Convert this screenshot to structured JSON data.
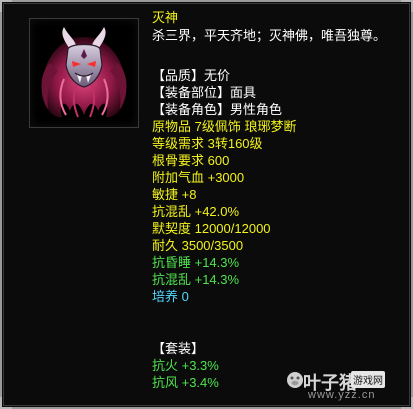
{
  "item": {
    "name": "灭神",
    "desc": "杀三界，平天齐地；灭神佛，唯吾独尊。",
    "icon": "demon-mask-icon"
  },
  "attributes": [
    {
      "text": "【品质】无价",
      "color": "white"
    },
    {
      "text": "【装备部位】面具",
      "color": "white"
    },
    {
      "text": "【装备角色】男性角色",
      "color": "white"
    },
    {
      "text": "原物品 7级佩饰 琅琊梦断",
      "color": "yellow"
    },
    {
      "text": "等级需求 3转160级",
      "color": "yellow"
    },
    {
      "text": "根骨要求 600",
      "color": "yellow"
    },
    {
      "text": "附加气血 +3000",
      "color": "yellow"
    },
    {
      "text": "敏捷 +8",
      "color": "yellow"
    },
    {
      "text": "抗混乱 +42.0%",
      "color": "yellow"
    },
    {
      "text": "默契度 12000/12000",
      "color": "yellow"
    },
    {
      "text": "耐久 3500/3500",
      "color": "yellow"
    },
    {
      "text": "抗昏睡 +14.3%",
      "color": "green"
    },
    {
      "text": "抗混乱 +14.3%",
      "color": "green"
    },
    {
      "text": "培养 0",
      "color": "cyan"
    }
  ],
  "set": {
    "title": "【套装】",
    "items": [
      {
        "text": "抗火 +3.3%"
      },
      {
        "text": "抗风 +3.4%"
      }
    ]
  },
  "watermark": {
    "brand": "叶子猪",
    "tag": "游戏网",
    "url": "www.yzz.cn"
  },
  "colors": {
    "yellow": "#f2f21c",
    "green": "#4fe34f",
    "cyan": "#4fd8ff",
    "white": "#ffffff"
  }
}
